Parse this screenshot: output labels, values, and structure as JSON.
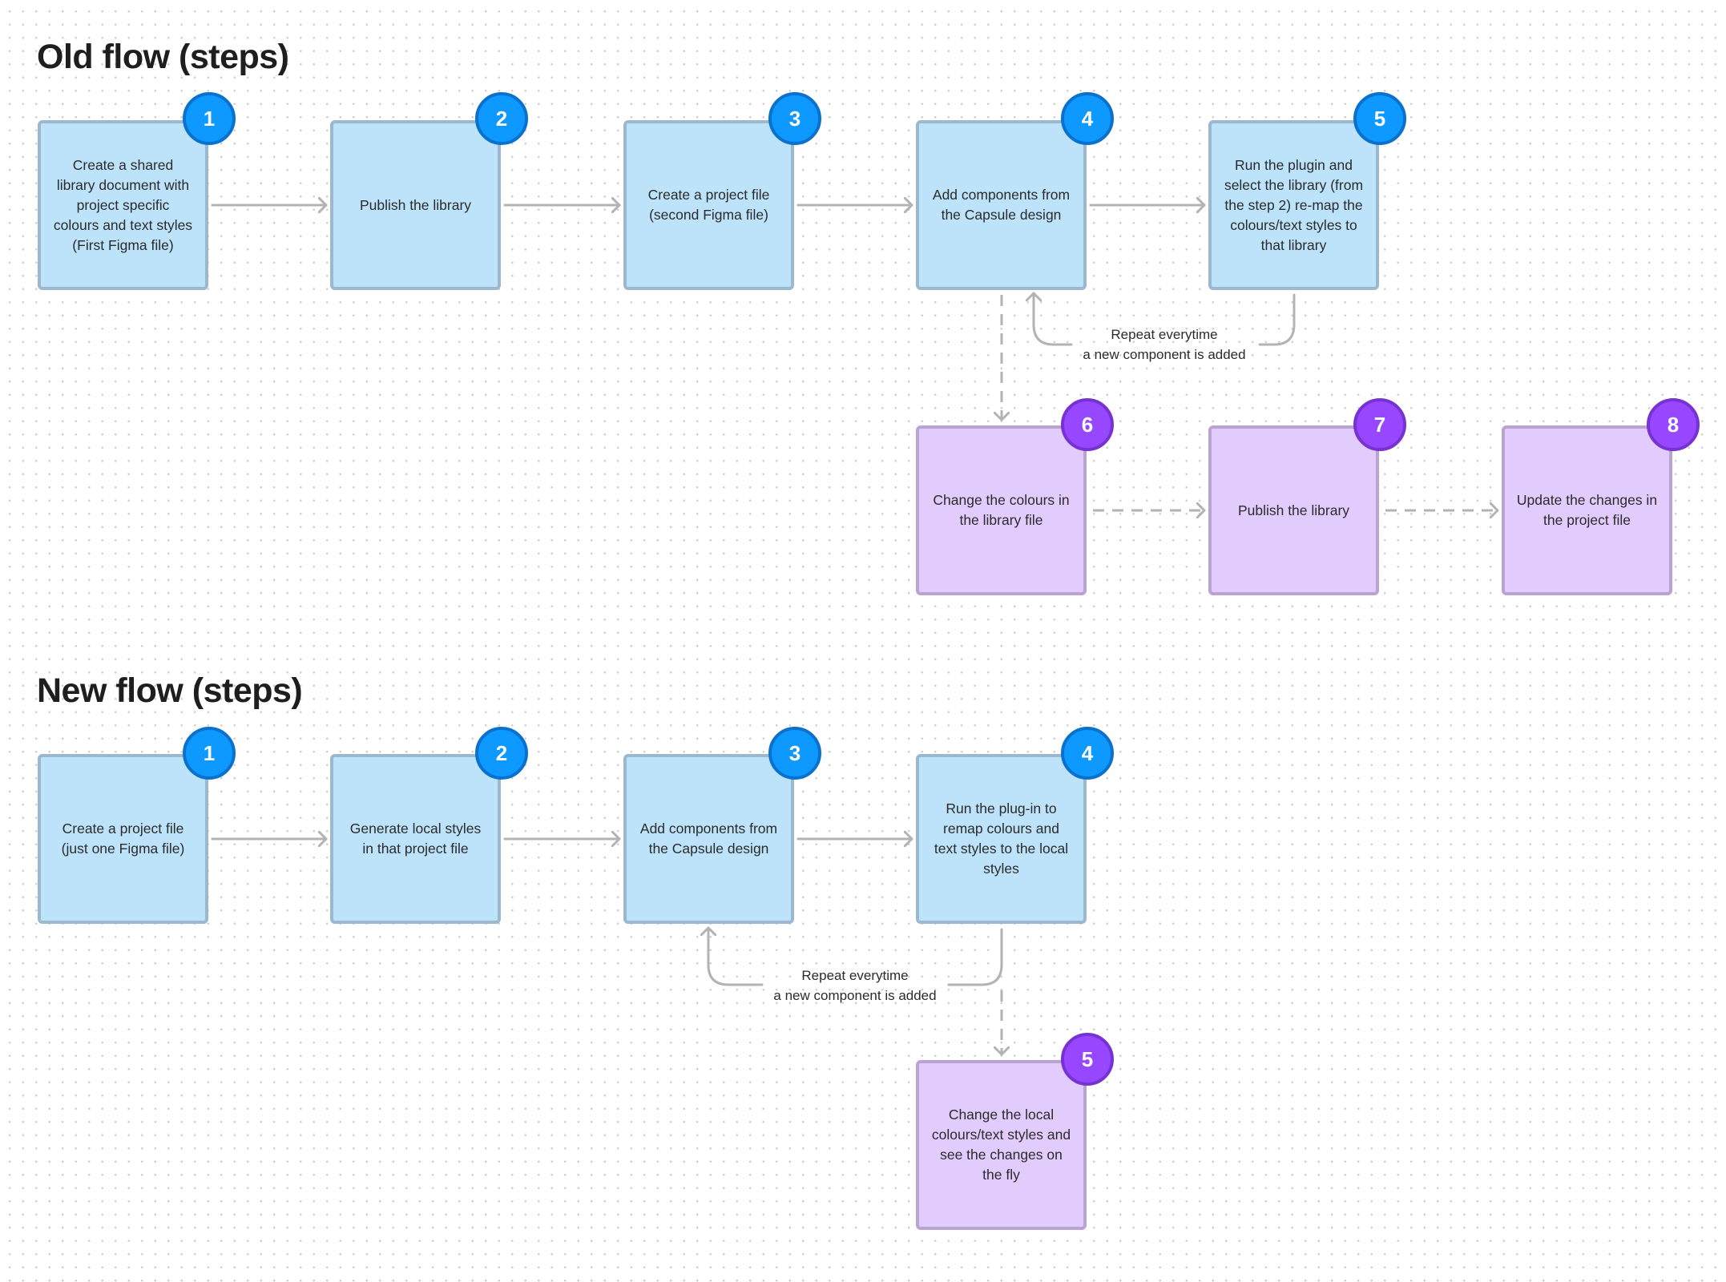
{
  "old_flow": {
    "title": "Old flow (steps)",
    "steps": [
      {
        "number": "1",
        "text": "Create a shared library document with project specific colours and text styles (First Figma file)",
        "color": "blue"
      },
      {
        "number": "2",
        "text": "Publish the library",
        "color": "blue"
      },
      {
        "number": "3",
        "text": "Create a project file (second Figma file)",
        "color": "blue"
      },
      {
        "number": "4",
        "text": "Add components from the Capsule design",
        "color": "blue"
      },
      {
        "number": "5",
        "text": "Run the plugin and select the library (from the step 2) re-map the colours/text styles to that library",
        "color": "blue"
      },
      {
        "number": "6",
        "text": "Change the colours in the library file",
        "color": "purple"
      },
      {
        "number": "7",
        "text": "Publish the library",
        "color": "purple"
      },
      {
        "number": "8",
        "text": "Update the changes in the project file",
        "color": "purple"
      }
    ],
    "loop_note": {
      "line1": "Repeat everytime",
      "line2": "a new component is added"
    }
  },
  "new_flow": {
    "title": "New flow (steps)",
    "steps": [
      {
        "number": "1",
        "text": "Create a project file (just one Figma file)",
        "color": "blue"
      },
      {
        "number": "2",
        "text": "Generate local styles in that project file",
        "color": "blue"
      },
      {
        "number": "3",
        "text": "Add components from the Capsule design",
        "color": "blue"
      },
      {
        "number": "4",
        "text": "Run the plug-in to remap colours and text styles to the local styles",
        "color": "blue"
      },
      {
        "number": "5",
        "text": "Change the local colours/text styles and see the changes on the fly",
        "color": "purple"
      }
    ],
    "loop_note": {
      "line1": "Repeat everytime",
      "line2": "a new component is added"
    }
  },
  "colors": {
    "step_blue_fill": "#bde3fb",
    "step_purple_fill": "#e2cbfd",
    "badge_blue": "#0d99ff",
    "badge_purple": "#9747ff",
    "connector": "#b3b3b3"
  }
}
